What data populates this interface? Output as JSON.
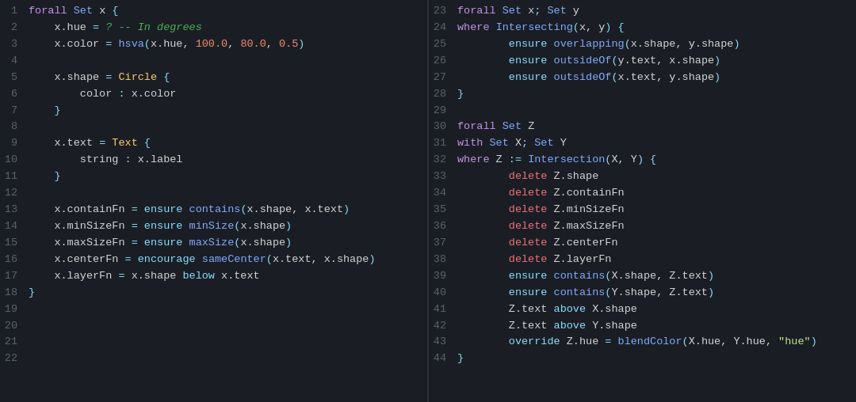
{
  "left_pane": {
    "lines": [
      {
        "num": "1",
        "tokens": [
          {
            "t": "kw-forall",
            "v": "forall "
          },
          {
            "t": "kw-set",
            "v": "Set"
          },
          {
            "t": "var",
            "v": " x "
          },
          {
            "t": "punct",
            "v": "{"
          }
        ]
      },
      {
        "num": "2",
        "tokens": [
          {
            "t": "var",
            "v": "    x.hue "
          },
          {
            "t": "assign",
            "v": "="
          },
          {
            "t": "comment",
            "v": " ? -- In degrees"
          }
        ]
      },
      {
        "num": "3",
        "tokens": [
          {
            "t": "var",
            "v": "    x.color "
          },
          {
            "t": "assign",
            "v": "="
          },
          {
            "t": "var",
            "v": " "
          },
          {
            "t": "fn-name",
            "v": "hsva"
          },
          {
            "t": "punct",
            "v": "("
          },
          {
            "t": "var",
            "v": "x.hue, "
          },
          {
            "t": "number",
            "v": "100.0"
          },
          {
            "t": "var",
            "v": ", "
          },
          {
            "t": "number",
            "v": "80.0"
          },
          {
            "t": "var",
            "v": ", "
          },
          {
            "t": "number",
            "v": "0.5"
          },
          {
            "t": "punct",
            "v": ")"
          }
        ]
      },
      {
        "num": "4",
        "tokens": []
      },
      {
        "num": "5",
        "tokens": [
          {
            "t": "var",
            "v": "    x.shape "
          },
          {
            "t": "assign",
            "v": "="
          },
          {
            "t": "var",
            "v": " "
          },
          {
            "t": "type-name",
            "v": "Circle"
          },
          {
            "t": "var",
            "v": " "
          },
          {
            "t": "punct",
            "v": "{"
          }
        ]
      },
      {
        "num": "6",
        "tokens": [
          {
            "t": "var",
            "v": "        color "
          },
          {
            "t": "punct",
            "v": ":"
          },
          {
            "t": "var",
            "v": " x.color"
          }
        ]
      },
      {
        "num": "7",
        "tokens": [
          {
            "t": "var",
            "v": "    "
          },
          {
            "t": "punct",
            "v": "}"
          }
        ]
      },
      {
        "num": "8",
        "tokens": []
      },
      {
        "num": "9",
        "tokens": [
          {
            "t": "var",
            "v": "    x.text "
          },
          {
            "t": "assign",
            "v": "="
          },
          {
            "t": "var",
            "v": " "
          },
          {
            "t": "type-name",
            "v": "Text"
          },
          {
            "t": "var",
            "v": " "
          },
          {
            "t": "punct",
            "v": "{"
          }
        ]
      },
      {
        "num": "10",
        "tokens": [
          {
            "t": "var",
            "v": "        string "
          },
          {
            "t": "punct",
            "v": ":"
          },
          {
            "t": "var",
            "v": " x.label"
          }
        ]
      },
      {
        "num": "11",
        "tokens": [
          {
            "t": "var",
            "v": "    "
          },
          {
            "t": "punct",
            "v": "}"
          }
        ]
      },
      {
        "num": "12",
        "tokens": []
      },
      {
        "num": "13",
        "tokens": [
          {
            "t": "var",
            "v": "    x.containFn "
          },
          {
            "t": "assign",
            "v": "="
          },
          {
            "t": "var",
            "v": " "
          },
          {
            "t": "kw-ensure",
            "v": "ensure"
          },
          {
            "t": "var",
            "v": " "
          },
          {
            "t": "fn-name",
            "v": "contains"
          },
          {
            "t": "punct",
            "v": "("
          },
          {
            "t": "var",
            "v": "x.shape, x.text"
          },
          {
            "t": "punct",
            "v": ")"
          }
        ]
      },
      {
        "num": "14",
        "tokens": [
          {
            "t": "var",
            "v": "    x.minSizeFn "
          },
          {
            "t": "assign",
            "v": "="
          },
          {
            "t": "var",
            "v": " "
          },
          {
            "t": "kw-ensure",
            "v": "ensure"
          },
          {
            "t": "var",
            "v": " "
          },
          {
            "t": "fn-name",
            "v": "minSize"
          },
          {
            "t": "punct",
            "v": "("
          },
          {
            "t": "var",
            "v": "x.shape"
          },
          {
            "t": "punct",
            "v": ")"
          }
        ]
      },
      {
        "num": "15",
        "tokens": [
          {
            "t": "var",
            "v": "    x.maxSizeFn "
          },
          {
            "t": "assign",
            "v": "="
          },
          {
            "t": "var",
            "v": " "
          },
          {
            "t": "kw-ensure",
            "v": "ensure"
          },
          {
            "t": "var",
            "v": " "
          },
          {
            "t": "fn-name",
            "v": "maxSize"
          },
          {
            "t": "punct",
            "v": "("
          },
          {
            "t": "var",
            "v": "x.shape"
          },
          {
            "t": "punct",
            "v": ")"
          }
        ]
      },
      {
        "num": "16",
        "tokens": [
          {
            "t": "var",
            "v": "    x.centerFn "
          },
          {
            "t": "assign",
            "v": "="
          },
          {
            "t": "var",
            "v": " "
          },
          {
            "t": "kw-encourage",
            "v": "encourage"
          },
          {
            "t": "var",
            "v": " "
          },
          {
            "t": "fn-name",
            "v": "sameCenter"
          },
          {
            "t": "punct",
            "v": "("
          },
          {
            "t": "var",
            "v": "x.text, x.shape"
          },
          {
            "t": "punct",
            "v": ")"
          }
        ]
      },
      {
        "num": "17",
        "tokens": [
          {
            "t": "var",
            "v": "    x.layerFn "
          },
          {
            "t": "assign",
            "v": "="
          },
          {
            "t": "var",
            "v": " x.shape "
          },
          {
            "t": "kw-below",
            "v": "below"
          },
          {
            "t": "var",
            "v": " x.text"
          }
        ]
      },
      {
        "num": "18",
        "tokens": [
          {
            "t": "punct",
            "v": "}"
          }
        ]
      },
      {
        "num": "19",
        "tokens": []
      },
      {
        "num": "20",
        "tokens": []
      },
      {
        "num": "21",
        "tokens": []
      },
      {
        "num": "22",
        "tokens": []
      }
    ]
  },
  "right_pane": {
    "lines": [
      {
        "num": "23",
        "tokens": [
          {
            "t": "kw-forall",
            "v": "forall "
          },
          {
            "t": "kw-set",
            "v": "Set"
          },
          {
            "t": "var",
            "v": " x"
          },
          {
            "t": "punct",
            "v": ";"
          },
          {
            "t": "var",
            "v": " "
          },
          {
            "t": "kw-set",
            "v": "Set"
          },
          {
            "t": "var",
            "v": " y"
          }
        ]
      },
      {
        "num": "24",
        "tokens": [
          {
            "t": "kw-where",
            "v": "where"
          },
          {
            "t": "var",
            "v": " "
          },
          {
            "t": "fn-name",
            "v": "Intersecting"
          },
          {
            "t": "punct",
            "v": "("
          },
          {
            "t": "var",
            "v": "x, y"
          },
          {
            "t": "punct",
            "v": ") {"
          }
        ]
      },
      {
        "num": "25",
        "tokens": [
          {
            "t": "var",
            "v": "        "
          },
          {
            "t": "kw-ensure",
            "v": "ensure"
          },
          {
            "t": "var",
            "v": " "
          },
          {
            "t": "fn-name",
            "v": "overlapping"
          },
          {
            "t": "punct",
            "v": "("
          },
          {
            "t": "var",
            "v": "x.shape, y.shape"
          },
          {
            "t": "punct",
            "v": ")"
          }
        ]
      },
      {
        "num": "26",
        "tokens": [
          {
            "t": "var",
            "v": "        "
          },
          {
            "t": "kw-ensure",
            "v": "ensure"
          },
          {
            "t": "var",
            "v": " "
          },
          {
            "t": "fn-name",
            "v": "outsideOf"
          },
          {
            "t": "punct",
            "v": "("
          },
          {
            "t": "var",
            "v": "y.text, x.shape"
          },
          {
            "t": "punct",
            "v": ")"
          }
        ]
      },
      {
        "num": "27",
        "tokens": [
          {
            "t": "var",
            "v": "        "
          },
          {
            "t": "kw-ensure",
            "v": "ensure"
          },
          {
            "t": "var",
            "v": " "
          },
          {
            "t": "fn-name",
            "v": "outsideOf"
          },
          {
            "t": "punct",
            "v": "("
          },
          {
            "t": "var",
            "v": "x.text, y.shape"
          },
          {
            "t": "punct",
            "v": ")"
          }
        ]
      },
      {
        "num": "28",
        "tokens": [
          {
            "t": "punct",
            "v": "}"
          }
        ]
      },
      {
        "num": "29",
        "tokens": []
      },
      {
        "num": "30",
        "tokens": [
          {
            "t": "kw-forall",
            "v": "forall "
          },
          {
            "t": "kw-set",
            "v": "Set"
          },
          {
            "t": "var",
            "v": " Z"
          }
        ]
      },
      {
        "num": "31",
        "tokens": [
          {
            "t": "kw-with",
            "v": "with "
          },
          {
            "t": "kw-set",
            "v": "Set"
          },
          {
            "t": "var",
            "v": " X"
          },
          {
            "t": "punct",
            "v": ";"
          },
          {
            "t": "var",
            "v": " "
          },
          {
            "t": "kw-set",
            "v": "Set"
          },
          {
            "t": "var",
            "v": " Y"
          }
        ]
      },
      {
        "num": "32",
        "tokens": [
          {
            "t": "kw-where",
            "v": "where"
          },
          {
            "t": "var",
            "v": " Z "
          },
          {
            "t": "assign",
            "v": ":="
          },
          {
            "t": "var",
            "v": " "
          },
          {
            "t": "fn-name",
            "v": "Intersection"
          },
          {
            "t": "punct",
            "v": "("
          },
          {
            "t": "var",
            "v": "X, Y"
          },
          {
            "t": "punct",
            "v": ") {"
          }
        ]
      },
      {
        "num": "33",
        "tokens": [
          {
            "t": "var",
            "v": "        "
          },
          {
            "t": "kw-delete",
            "v": "delete"
          },
          {
            "t": "var",
            "v": " Z.shape"
          }
        ]
      },
      {
        "num": "34",
        "tokens": [
          {
            "t": "var",
            "v": "        "
          },
          {
            "t": "kw-delete",
            "v": "delete"
          },
          {
            "t": "var",
            "v": " Z.containFn"
          }
        ]
      },
      {
        "num": "35",
        "tokens": [
          {
            "t": "var",
            "v": "        "
          },
          {
            "t": "kw-delete",
            "v": "delete"
          },
          {
            "t": "var",
            "v": " Z.minSizeFn"
          }
        ]
      },
      {
        "num": "36",
        "tokens": [
          {
            "t": "var",
            "v": "        "
          },
          {
            "t": "kw-delete",
            "v": "delete"
          },
          {
            "t": "var",
            "v": " Z.maxSizeFn"
          }
        ]
      },
      {
        "num": "37",
        "tokens": [
          {
            "t": "var",
            "v": "        "
          },
          {
            "t": "kw-delete",
            "v": "delete"
          },
          {
            "t": "var",
            "v": " Z.centerFn"
          }
        ]
      },
      {
        "num": "38",
        "tokens": [
          {
            "t": "var",
            "v": "        "
          },
          {
            "t": "kw-delete",
            "v": "delete"
          },
          {
            "t": "var",
            "v": " Z.layerFn"
          }
        ]
      },
      {
        "num": "39",
        "tokens": [
          {
            "t": "var",
            "v": "        "
          },
          {
            "t": "kw-ensure",
            "v": "ensure"
          },
          {
            "t": "var",
            "v": " "
          },
          {
            "t": "fn-name",
            "v": "contains"
          },
          {
            "t": "punct",
            "v": "("
          },
          {
            "t": "var",
            "v": "X.shape, Z.text"
          },
          {
            "t": "punct",
            "v": ")"
          }
        ]
      },
      {
        "num": "40",
        "tokens": [
          {
            "t": "var",
            "v": "        "
          },
          {
            "t": "kw-ensure",
            "v": "ensure"
          },
          {
            "t": "var",
            "v": " "
          },
          {
            "t": "fn-name",
            "v": "contains"
          },
          {
            "t": "punct",
            "v": "("
          },
          {
            "t": "var",
            "v": "Y.shape, Z.text"
          },
          {
            "t": "punct",
            "v": ")"
          }
        ]
      },
      {
        "num": "41",
        "tokens": [
          {
            "t": "var",
            "v": "        Z.text "
          },
          {
            "t": "kw-above",
            "v": "above"
          },
          {
            "t": "var",
            "v": " X.shape"
          }
        ]
      },
      {
        "num": "42",
        "tokens": [
          {
            "t": "var",
            "v": "        Z.text "
          },
          {
            "t": "kw-above",
            "v": "above"
          },
          {
            "t": "var",
            "v": " Y.shape"
          }
        ]
      },
      {
        "num": "43",
        "tokens": [
          {
            "t": "var",
            "v": "        "
          },
          {
            "t": "kw-override",
            "v": "override"
          },
          {
            "t": "var",
            "v": " Z.hue "
          },
          {
            "t": "assign",
            "v": "="
          },
          {
            "t": "var",
            "v": " "
          },
          {
            "t": "fn-name",
            "v": "blendColor"
          },
          {
            "t": "punct",
            "v": "("
          },
          {
            "t": "var",
            "v": "X.hue, Y.hue, "
          },
          {
            "t": "string",
            "v": "\"hue\""
          },
          {
            "t": "punct",
            "v": ")"
          }
        ]
      },
      {
        "num": "44",
        "tokens": [
          {
            "t": "punct",
            "v": "}"
          }
        ]
      }
    ]
  }
}
